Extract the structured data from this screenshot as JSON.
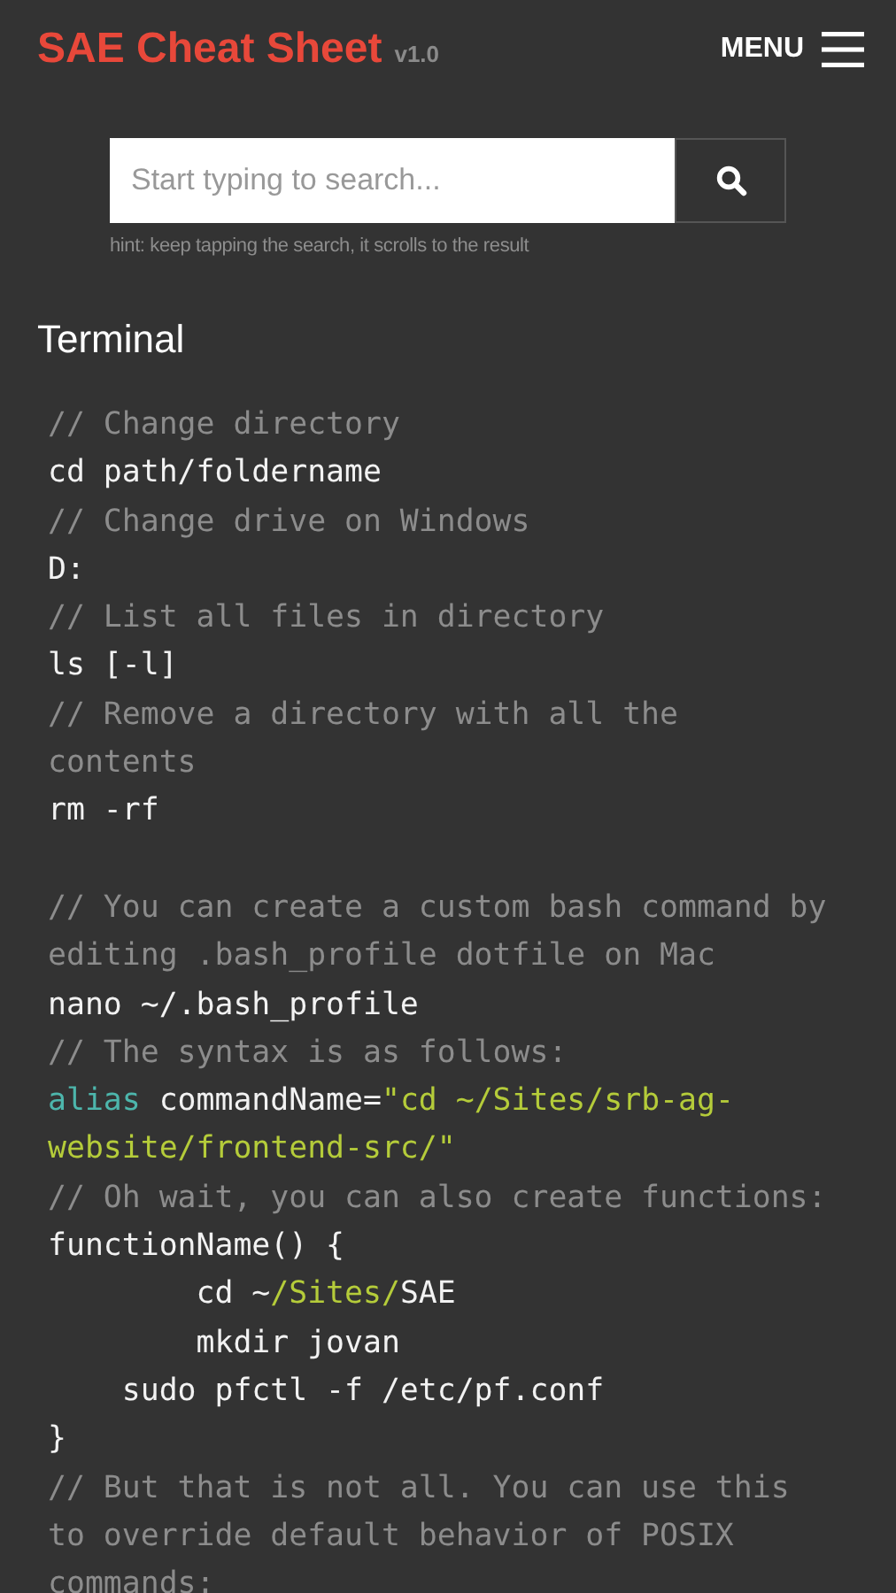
{
  "header": {
    "title": "SAE Cheat Sheet",
    "version": "v1.0",
    "menu_label": "MENU"
  },
  "search": {
    "placeholder": "Start typing to search...",
    "hint": "hint: keep tapping the search, it scrolls to the result"
  },
  "section": {
    "heading": "Terminal",
    "lines": [
      {
        "kind": "code",
        "segments": [
          {
            "kind": "comment",
            "text": "// Change directory"
          }
        ]
      },
      {
        "kind": "code",
        "segments": [
          {
            "kind": "plain",
            "text": "cd path/foldername"
          }
        ]
      },
      {
        "kind": "code",
        "segments": [
          {
            "kind": "comment",
            "text": "// Change drive on Windows"
          }
        ]
      },
      {
        "kind": "code",
        "segments": [
          {
            "kind": "plain",
            "text": "D:"
          }
        ]
      },
      {
        "kind": "code",
        "segments": [
          {
            "kind": "comment",
            "text": "// List all files in directory"
          }
        ]
      },
      {
        "kind": "code",
        "segments": [
          {
            "kind": "plain",
            "text": "ls [-l]"
          }
        ]
      },
      {
        "kind": "code",
        "segments": [
          {
            "kind": "comment",
            "text": "// Remove a directory with all the"
          }
        ]
      },
      {
        "kind": "code",
        "segments": [
          {
            "kind": "comment",
            "text": "contents"
          }
        ]
      },
      {
        "kind": "code",
        "segments": [
          {
            "kind": "plain",
            "text": "rm -rf"
          }
        ]
      },
      {
        "kind": "blank"
      },
      {
        "kind": "code",
        "segments": [
          {
            "kind": "comment",
            "text": "// You can create a custom bash command by"
          }
        ]
      },
      {
        "kind": "code",
        "segments": [
          {
            "kind": "comment",
            "text": "editing .bash_profile dotfile on Mac"
          }
        ]
      },
      {
        "kind": "code",
        "segments": [
          {
            "kind": "plain",
            "text": "nano ~/.bash_profile"
          }
        ]
      },
      {
        "kind": "code",
        "segments": [
          {
            "kind": "comment",
            "text": "// The syntax is as follows:"
          }
        ]
      },
      {
        "kind": "code",
        "segments": [
          {
            "kind": "keyword",
            "text": "alias"
          },
          {
            "kind": "plain",
            "text": " commandName="
          },
          {
            "kind": "string",
            "text": "\"cd ~/Sites/srb-ag-"
          }
        ]
      },
      {
        "kind": "code",
        "segments": [
          {
            "kind": "string",
            "text": "website/frontend-src/\""
          }
        ]
      },
      {
        "kind": "code",
        "segments": [
          {
            "kind": "comment",
            "text": "// Oh wait, you can also create functions:"
          }
        ]
      },
      {
        "kind": "code",
        "segments": [
          {
            "kind": "plain",
            "text": "functionName() {"
          }
        ]
      },
      {
        "kind": "code",
        "segments": [
          {
            "kind": "plain",
            "text": "        cd ~"
          },
          {
            "kind": "string",
            "text": "/Sites/"
          },
          {
            "kind": "plain",
            "text": "SAE"
          }
        ]
      },
      {
        "kind": "code",
        "segments": [
          {
            "kind": "plain",
            "text": "        mkdir jovan"
          }
        ]
      },
      {
        "kind": "code",
        "segments": [
          {
            "kind": "plain",
            "text": "    sudo pfctl -f /etc/pf.conf"
          }
        ]
      },
      {
        "kind": "code",
        "segments": [
          {
            "kind": "plain",
            "text": "}"
          }
        ]
      },
      {
        "kind": "code",
        "segments": [
          {
            "kind": "comment",
            "text": "// But that is not all. You can use this"
          }
        ]
      },
      {
        "kind": "code",
        "segments": [
          {
            "kind": "comment",
            "text": "to override default behavior of POSIX"
          }
        ]
      },
      {
        "kind": "code",
        "segments": [
          {
            "kind": "comment",
            "text": "commands:"
          }
        ]
      }
    ]
  }
}
